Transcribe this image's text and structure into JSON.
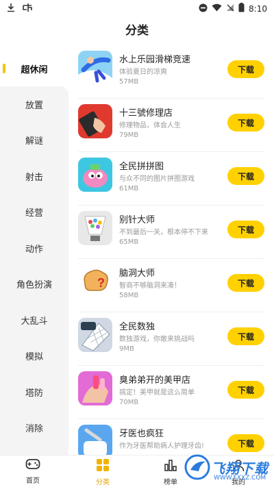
{
  "statusbar": {
    "time": "8:10"
  },
  "page_title": "分类",
  "sidebar": {
    "items": [
      {
        "label": "超休闲",
        "active": true
      },
      {
        "label": "放置"
      },
      {
        "label": "解谜"
      },
      {
        "label": "射击"
      },
      {
        "label": "经营"
      },
      {
        "label": "动作"
      },
      {
        "label": "角色扮演"
      },
      {
        "label": "大乱斗"
      },
      {
        "label": "模拟"
      },
      {
        "label": "塔防"
      },
      {
        "label": "消除"
      }
    ]
  },
  "apps": [
    {
      "name": "水上乐园滑梯竞速",
      "desc": "体验夏日的凉爽",
      "size": "57MB",
      "button": "下载"
    },
    {
      "name": "十三號修理店",
      "desc": "修理物品，体会人生",
      "size": "79MB",
      "button": "下载"
    },
    {
      "name": "全民拼拼图",
      "desc": "与众不同的图片拼图游戏",
      "size": "61MB",
      "button": "下载"
    },
    {
      "name": "别针大师",
      "desc": "不到最后一关，根本停不下来",
      "size": "65MB",
      "button": "下载"
    },
    {
      "name": "脑洞大师",
      "desc": "智商不够脑洞来凑！",
      "size": "58MB",
      "button": "下载"
    },
    {
      "name": "全民数独",
      "desc": "数独游戏，你敢来挑战吗",
      "size": "9MB",
      "button": "下载"
    },
    {
      "name": "臭弟弟开的美甲店",
      "desc": "搞定！美甲就是这么简单",
      "size": "70MB",
      "button": "下载"
    },
    {
      "name": "牙医也疯狂",
      "desc": "作为牙医帮助病人护理牙齿!",
      "size": "",
      "button": "下载"
    }
  ],
  "tabbar": {
    "items": [
      {
        "label": "首页",
        "icon": "gamepad-icon"
      },
      {
        "label": "分类",
        "icon": "grid-icon",
        "active": true
      },
      {
        "label": "榜单",
        "icon": "rank-icon"
      },
      {
        "label": "我的",
        "icon": "profile-icon"
      }
    ]
  },
  "watermark": {
    "text": "飞翔下载",
    "sub": "WWW.FXXZ.COM"
  },
  "colors": {
    "accent": "#ffd100",
    "sidebar_bg": "#f4f4f4",
    "active_tab": "#e3a500"
  }
}
